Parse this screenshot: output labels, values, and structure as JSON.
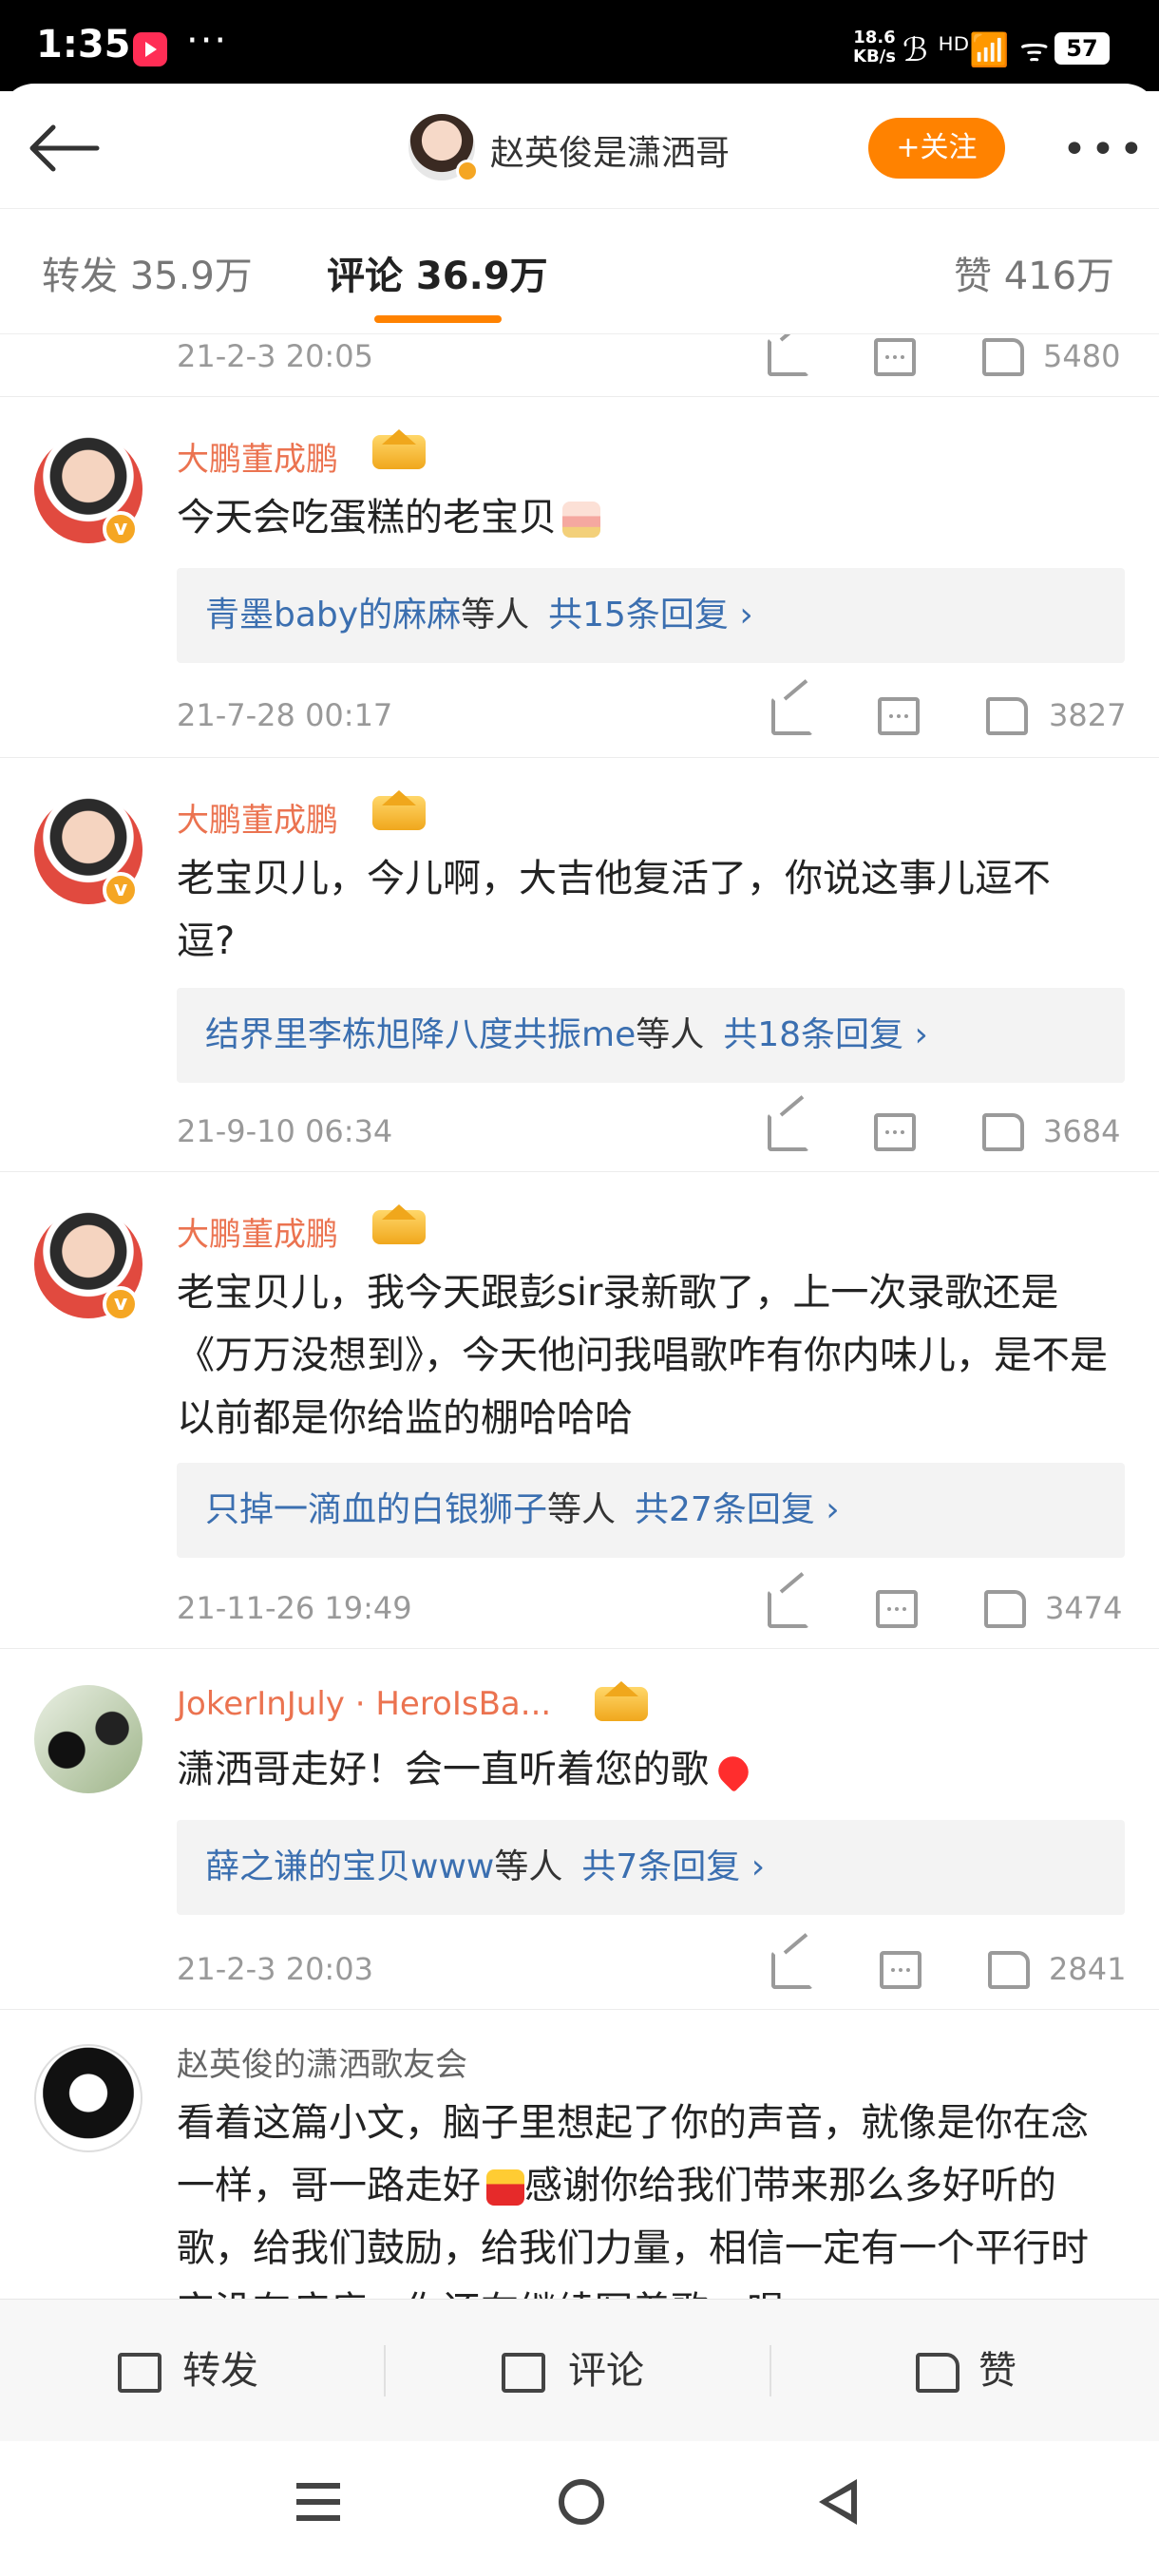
{
  "status_bar": {
    "time": "1:35",
    "dots": "···",
    "net_speed_value": "18.6",
    "net_speed_unit": "KB/s",
    "icons": "ℬ ᴴᴰ📶 ᯤ",
    "battery": "57"
  },
  "header": {
    "back_icon": "back-arrow-icon",
    "name": "赵英俊是潇洒哥",
    "follow_label": "+关注",
    "more_icon": "more-icon"
  },
  "tabs": {
    "repost": "转发 35.9万",
    "comments": "评论 36.9万",
    "likes": "赞 416万"
  },
  "top_partial": {
    "date": "21-2-3 20:05",
    "likes": "5480"
  },
  "comments": [
    {
      "name": "大鹏董成鹏",
      "text": "今天会吃蛋糕的老宝贝",
      "reply_names": "青墨baby的麻麻",
      "reply_suffix": "等人",
      "reply_count": "共15条回复 ›",
      "date": "21-7-28 00:17",
      "likes": "3827"
    },
    {
      "name": "大鹏董成鹏",
      "text": "老宝贝儿，今儿啊，大吉他复活了，你说这事儿逗不逗?",
      "reply_names": "结界里李栋旭降八度共振me",
      "reply_suffix": "等人",
      "reply_count": "共18条回复 ›",
      "date": "21-9-10 06:34",
      "likes": "3684"
    },
    {
      "name": "大鹏董成鹏",
      "text": "老宝贝儿，我今天跟彭sir录新歌了，上一次录歌还是《万万没想到》，今天他问我唱歌咋有你内味儿，是不是以前都是你给监的棚哈哈哈",
      "reply_names": "只掉一滴血的白银狮子",
      "reply_suffix": "等人",
      "reply_count": "共27条回复 ›",
      "date": "21-11-26 19:49",
      "likes": "3474"
    },
    {
      "name": "JokerInJuly · HeroIsBa...",
      "text": "潇洒哥走好！会一直听着您的歌",
      "reply_names": "薛之谦的宝贝www",
      "reply_suffix": "等人",
      "reply_count": "共7条回复 ›",
      "date": "21-2-3 20:03",
      "likes": "2841"
    },
    {
      "name": "赵英俊的潇洒歌友会",
      "text_a": "看着这篇小文，脑子里想起了你的声音，就像是你在念一样，哥一路走好",
      "text_b": "感谢你给我们带来那么多好听的歌，给我们鼓励，给我们力量，相信一定有一个平行时空没有病痛，你还在继续写着歌，唱"
    }
  ],
  "bottom_bar": {
    "repost": "转发",
    "comment": "评论",
    "like": "赞"
  },
  "colors": {
    "accent": "#ff8200",
    "username": "#eb7350",
    "link": "#3b6fb0"
  }
}
